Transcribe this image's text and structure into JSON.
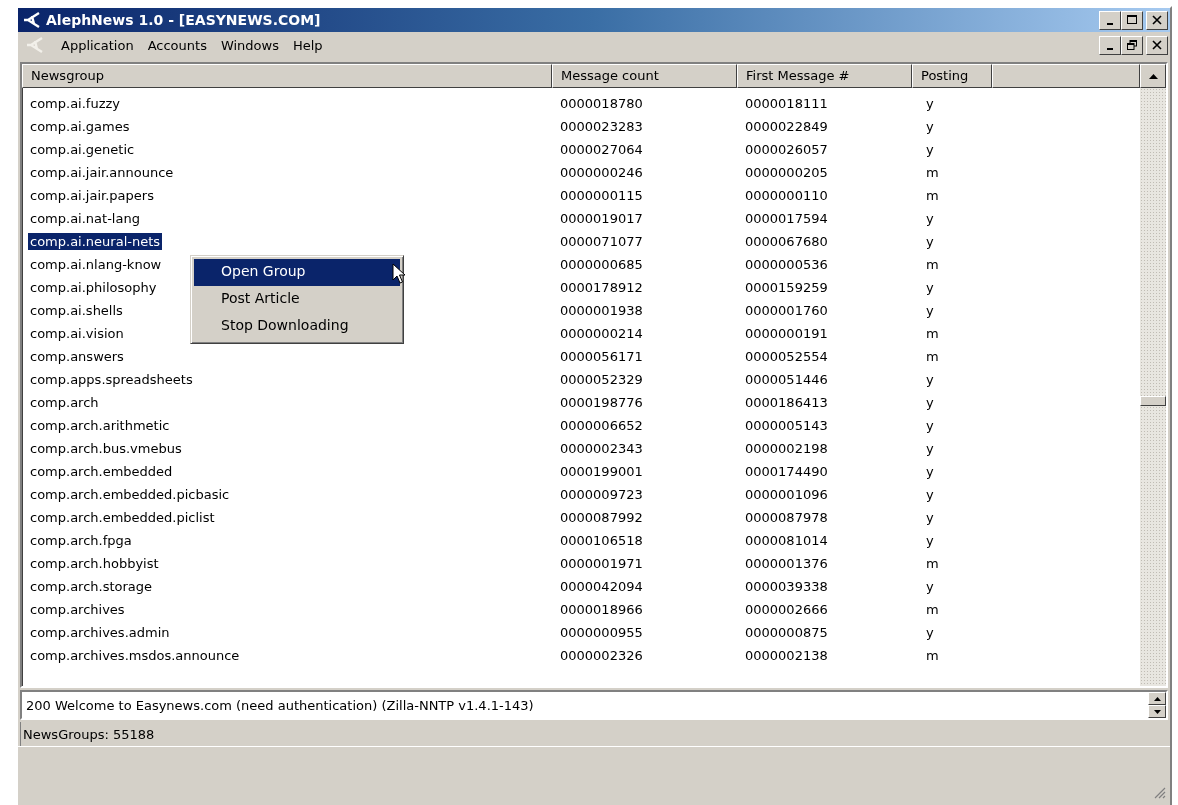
{
  "window": {
    "title": "AlephNews 1.0 - [EASYNEWS.COM]"
  },
  "menu": [
    "Application",
    "Accounts",
    "Windows",
    "Help"
  ],
  "table": {
    "columns": [
      "Newsgroup",
      "Message count",
      "First Message #",
      "Posting"
    ],
    "rows": [
      {
        "cells": [
          "comp.ai.fuzzy",
          "0000018780",
          "0000018111",
          "y"
        ],
        "selected": false
      },
      {
        "cells": [
          "comp.ai.games",
          "0000023283",
          "0000022849",
          "y"
        ],
        "selected": false
      },
      {
        "cells": [
          "comp.ai.genetic",
          "0000027064",
          "0000026057",
          "y"
        ],
        "selected": false
      },
      {
        "cells": [
          "comp.ai.jair.announce",
          "0000000246",
          "0000000205",
          "m"
        ],
        "selected": false
      },
      {
        "cells": [
          "comp.ai.jair.papers",
          "0000000115",
          "0000000110",
          "m"
        ],
        "selected": false
      },
      {
        "cells": [
          "comp.ai.nat-lang",
          "0000019017",
          "0000017594",
          "y"
        ],
        "selected": false
      },
      {
        "cells": [
          "comp.ai.neural-nets",
          "0000071077",
          "0000067680",
          "y"
        ],
        "selected": true
      },
      {
        "cells": [
          "comp.ai.nlang-know",
          "0000000685",
          "0000000536",
          "m"
        ],
        "selected": false
      },
      {
        "cells": [
          "comp.ai.philosophy",
          "0000178912",
          "0000159259",
          "y"
        ],
        "selected": false
      },
      {
        "cells": [
          "comp.ai.shells",
          "0000001938",
          "0000001760",
          "y"
        ],
        "selected": false
      },
      {
        "cells": [
          "comp.ai.vision",
          "0000000214",
          "0000000191",
          "m"
        ],
        "selected": false
      },
      {
        "cells": [
          "comp.answers",
          "0000056171",
          "0000052554",
          "m"
        ],
        "selected": false
      },
      {
        "cells": [
          "comp.apps.spreadsheets",
          "0000052329",
          "0000051446",
          "y"
        ],
        "selected": false
      },
      {
        "cells": [
          "comp.arch",
          "0000198776",
          "0000186413",
          "y"
        ],
        "selected": false
      },
      {
        "cells": [
          "comp.arch.arithmetic",
          "0000006652",
          "0000005143",
          "y"
        ],
        "selected": false
      },
      {
        "cells": [
          "comp.arch.bus.vmebus",
          "0000002343",
          "0000002198",
          "y"
        ],
        "selected": false
      },
      {
        "cells": [
          "comp.arch.embedded",
          "0000199001",
          "0000174490",
          "y"
        ],
        "selected": false
      },
      {
        "cells": [
          "comp.arch.embedded.picbasic",
          "0000009723",
          "0000001096",
          "y"
        ],
        "selected": false
      },
      {
        "cells": [
          "comp.arch.embedded.piclist",
          "0000087992",
          "0000087978",
          "y"
        ],
        "selected": false
      },
      {
        "cells": [
          "comp.arch.fpga",
          "0000106518",
          "0000081014",
          "y"
        ],
        "selected": false
      },
      {
        "cells": [
          "comp.arch.hobbyist",
          "0000001971",
          "0000001376",
          "m"
        ],
        "selected": false
      },
      {
        "cells": [
          "comp.arch.storage",
          "0000042094",
          "0000039338",
          "y"
        ],
        "selected": false
      },
      {
        "cells": [
          "comp.archives",
          "0000018966",
          "0000002666",
          "m"
        ],
        "selected": false
      },
      {
        "cells": [
          "comp.archives.admin",
          "0000000955",
          "0000000875",
          "y"
        ],
        "selected": false
      },
      {
        "cells": [
          "comp.archives.msdos.announce",
          "0000002326",
          "0000002138",
          "m"
        ],
        "selected": false
      }
    ]
  },
  "context_menu": {
    "items": [
      {
        "label": "Open Group",
        "selected": true
      },
      {
        "label": "Post Article",
        "selected": false
      },
      {
        "label": "Stop Downloading",
        "selected": false
      }
    ]
  },
  "server_message": "200 Welcome to Easynews.com (need authentication) (Zilla-NNTP v1.4.1-143)",
  "status_bar": "NewsGroups: 55188"
}
